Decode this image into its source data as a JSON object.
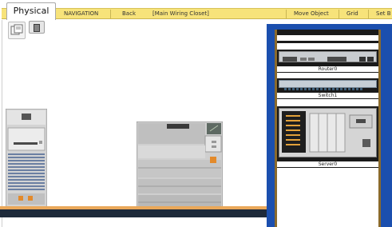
{
  "toolbar": {
    "tab_physical": "Physical",
    "navigation_label": "NAVIGATION",
    "back_label": "Back",
    "location_label": "[Main Wiring Closet]",
    "move_object_label": "Move Object",
    "grid_label": "Grid",
    "set_tiled_label": "Set B"
  },
  "rack": {
    "router_label": "Router0",
    "switch_label": "Switch1",
    "server_label": "Server0"
  },
  "colors": {
    "toolbar_bg": "#f7e37a",
    "rack_frame": "#1b4fae",
    "rack_inner": "#1a1a1a",
    "floor": "#1e2a3a",
    "floor_trim": "#eaa85a"
  },
  "icons": {
    "nav_panel": "navigation-panel-icon",
    "list": "list-icon"
  }
}
